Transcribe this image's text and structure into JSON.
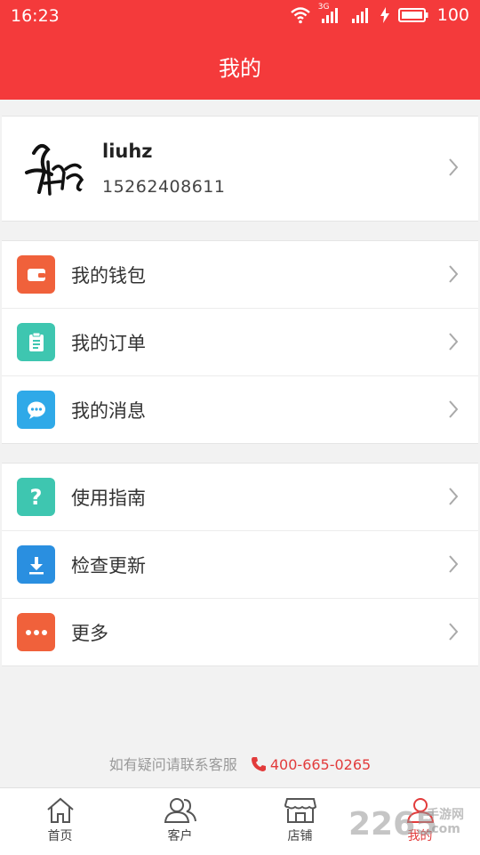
{
  "status_bar": {
    "time": "16:23",
    "network": "3G",
    "battery": "100"
  },
  "header": {
    "title": "我的"
  },
  "profile": {
    "name": "liuhz",
    "phone": "15262408611"
  },
  "menu_groups": [
    [
      {
        "label": "我的钱包",
        "icon": "wallet-icon",
        "color": "#f0613b"
      },
      {
        "label": "我的订单",
        "icon": "clipboard-icon",
        "color": "#3ec6b0"
      },
      {
        "label": "我的消息",
        "icon": "message-icon",
        "color": "#2fa9e8"
      }
    ],
    [
      {
        "label": "使用指南",
        "icon": "question-icon",
        "color": "#3ec6b0"
      },
      {
        "label": "检查更新",
        "icon": "download-icon",
        "color": "#2a8fe0"
      },
      {
        "label": "更多",
        "icon": "more-icon",
        "color": "#f0613b"
      }
    ]
  ],
  "footer": {
    "hint": "如有疑问请联系客服",
    "phone": "400-665-0265"
  },
  "tabs": [
    {
      "label": "首页",
      "icon": "home-icon"
    },
    {
      "label": "客户",
      "icon": "customers-icon"
    },
    {
      "label": "店铺",
      "icon": "store-icon"
    },
    {
      "label": "我的",
      "icon": "person-icon",
      "active": true
    }
  ],
  "watermark": {
    "text": "2265",
    "site": "手游网",
    "domain": ".com"
  },
  "colors": {
    "primary": "#f43a3b",
    "background": "#f2f2f2",
    "text": "#333333"
  }
}
